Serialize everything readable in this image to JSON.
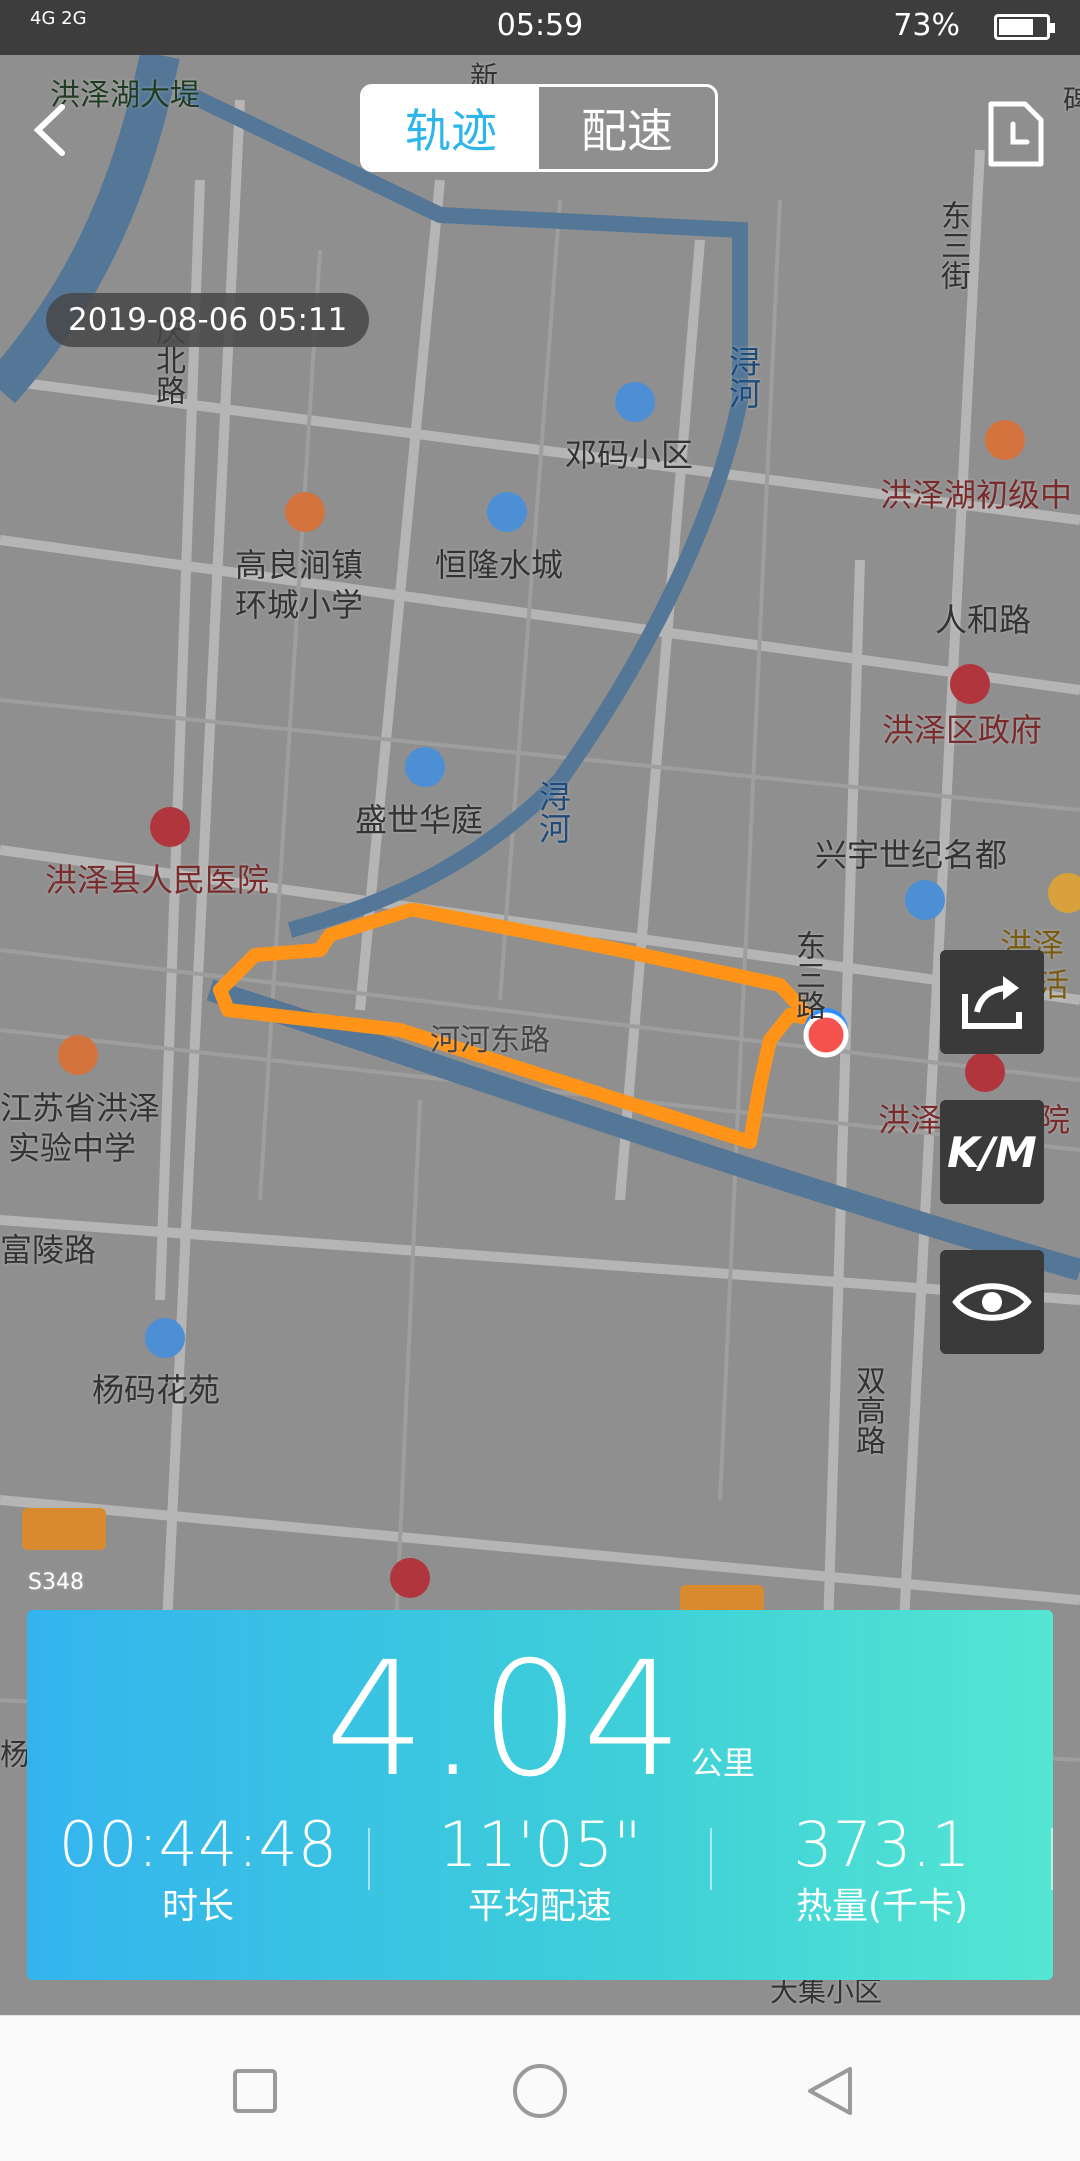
{
  "status_bar": {
    "signal": "4G 2G",
    "time": "05:59",
    "battery": "73%",
    "battery_level": 0.73
  },
  "header": {
    "tabs": [
      {
        "label": "轨迹",
        "active": true
      },
      {
        "label": "配速",
        "active": false
      }
    ]
  },
  "date_pill": "2019-08-06 05:11",
  "map_labels": [
    "洪泽湖大堤",
    "新",
    "东三街",
    "碑",
    "洪泽湖初级中",
    "浔河",
    "邓码小区",
    "庆北路",
    "高良涧镇",
    "环城小学",
    "恒隆水城",
    "人和路",
    "洪泽区政府",
    "盛世华庭",
    "浔河",
    "洪泽县人民医院",
    "兴宇世纪名都",
    "洪泽",
    "生活",
    "东三路",
    "河河东路",
    "江苏省洪泽",
    "实验中学",
    "洪泽区中医院",
    "富陵路",
    "杨码花苑",
    "双高路",
    "S348",
    "S348",
    "杨",
    "大集小区",
    "新"
  ],
  "side_buttons": {
    "share": "share-icon",
    "unit": "K/M",
    "eye": "eye-icon"
  },
  "stats": {
    "distance": "4.04",
    "distance_unit": "公里",
    "duration": "00:44:48",
    "duration_label": "时长",
    "pace": "11'05\"",
    "pace_label": "平均配速",
    "calories": "373.1",
    "calories_label": "热量(千卡)"
  },
  "nav": {
    "square": "recent-apps-icon",
    "circle": "home-icon",
    "triangle": "back-triangle-icon"
  },
  "colors": {
    "accent": "#2eb6ea",
    "track": "#ff9419",
    "map_bg": "#8f8f8f"
  }
}
